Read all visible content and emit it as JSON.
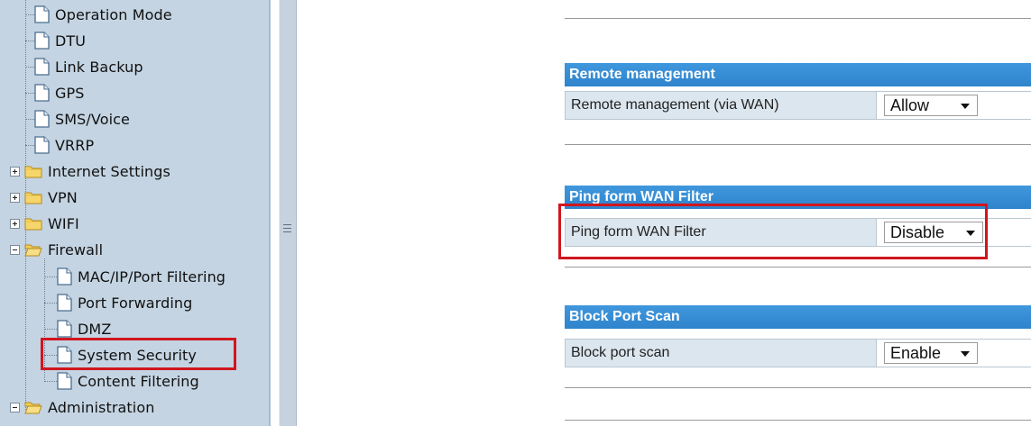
{
  "sidebar": {
    "items": [
      {
        "label": "Operation Mode",
        "type": "page"
      },
      {
        "label": "DTU",
        "type": "page"
      },
      {
        "label": "Link Backup",
        "type": "page"
      },
      {
        "label": "GPS",
        "type": "page"
      },
      {
        "label": "SMS/Voice",
        "type": "page"
      },
      {
        "label": "VRRP",
        "type": "page"
      },
      {
        "label": "Internet Settings",
        "type": "folder",
        "expander": "plus"
      },
      {
        "label": "VPN",
        "type": "folder",
        "expander": "plus"
      },
      {
        "label": "WIFI",
        "type": "folder",
        "expander": "plus"
      },
      {
        "label": "Firewall",
        "type": "folder-open",
        "expander": "minus"
      },
      {
        "label": "MAC/IP/Port Filtering",
        "type": "page"
      },
      {
        "label": "Port Forwarding",
        "type": "page"
      },
      {
        "label": "DMZ",
        "type": "page"
      },
      {
        "label": "System Security",
        "type": "page",
        "selected": true
      },
      {
        "label": "Content Filtering",
        "type": "page"
      },
      {
        "label": "Administration",
        "type": "folder-open",
        "expander": "minus"
      }
    ]
  },
  "sections": {
    "remote": {
      "title": "Remote management",
      "label": "Remote management (via WAN)",
      "value": "Allow"
    },
    "ping": {
      "title": "Ping form WAN Filter",
      "label": "Ping form WAN Filter",
      "value": "Disable"
    },
    "portscan": {
      "title": "Block Port Scan",
      "label": "Block port scan",
      "value": "Enable"
    }
  },
  "colors": {
    "sidebar_bg": "#c4d4e2",
    "header_blue": "#3a8fd6",
    "highlight_red": "#d0161e",
    "label_bg": "#dce6ee"
  },
  "icons": {
    "page": "document-icon",
    "folder": "folder-icon",
    "plus": "expand-plus-icon",
    "minus": "collapse-minus-icon",
    "grip": "splitter-grip-icon"
  }
}
